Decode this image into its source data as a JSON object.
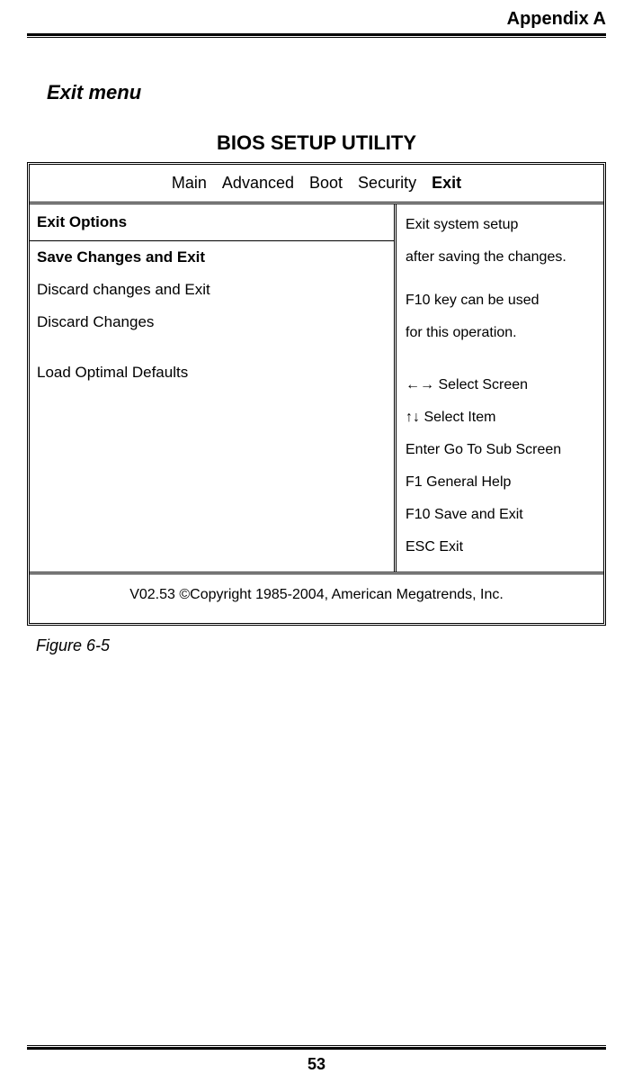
{
  "header": {
    "appendix": "Appendix A"
  },
  "section": {
    "title": "Exit menu"
  },
  "bios": {
    "title": "BIOS SETUP UTILITY",
    "tabs": {
      "main": "Main",
      "advanced": "Advanced",
      "boot": "Boot",
      "security": "Security",
      "exit": "Exit"
    },
    "left": {
      "options_header": "Exit Options",
      "items": {
        "save_exit": "Save Changes and Exit",
        "discard_exit": "Discard changes and Exit",
        "discard": "Discard Changes",
        "load_defaults": "Load Optimal Defaults"
      }
    },
    "right": {
      "help1": "Exit system setup",
      "help2": "after saving the changes.",
      "help3": "F10 key can be used",
      "help4": "for this operation.",
      "nav": {
        "select_screen": "←→ Select Screen",
        "select_item": "↑↓ Select Item",
        "enter": "Enter Go To Sub Screen",
        "f1": "F1  General Help",
        "f10": "F10 Save and Exit",
        "esc": "ESC Exit"
      }
    },
    "footer": "V02.53 ©Copyright 1985-2004, American Megatrends, Inc."
  },
  "figure": {
    "caption": "Figure 6-5"
  },
  "page": {
    "number": "53"
  }
}
